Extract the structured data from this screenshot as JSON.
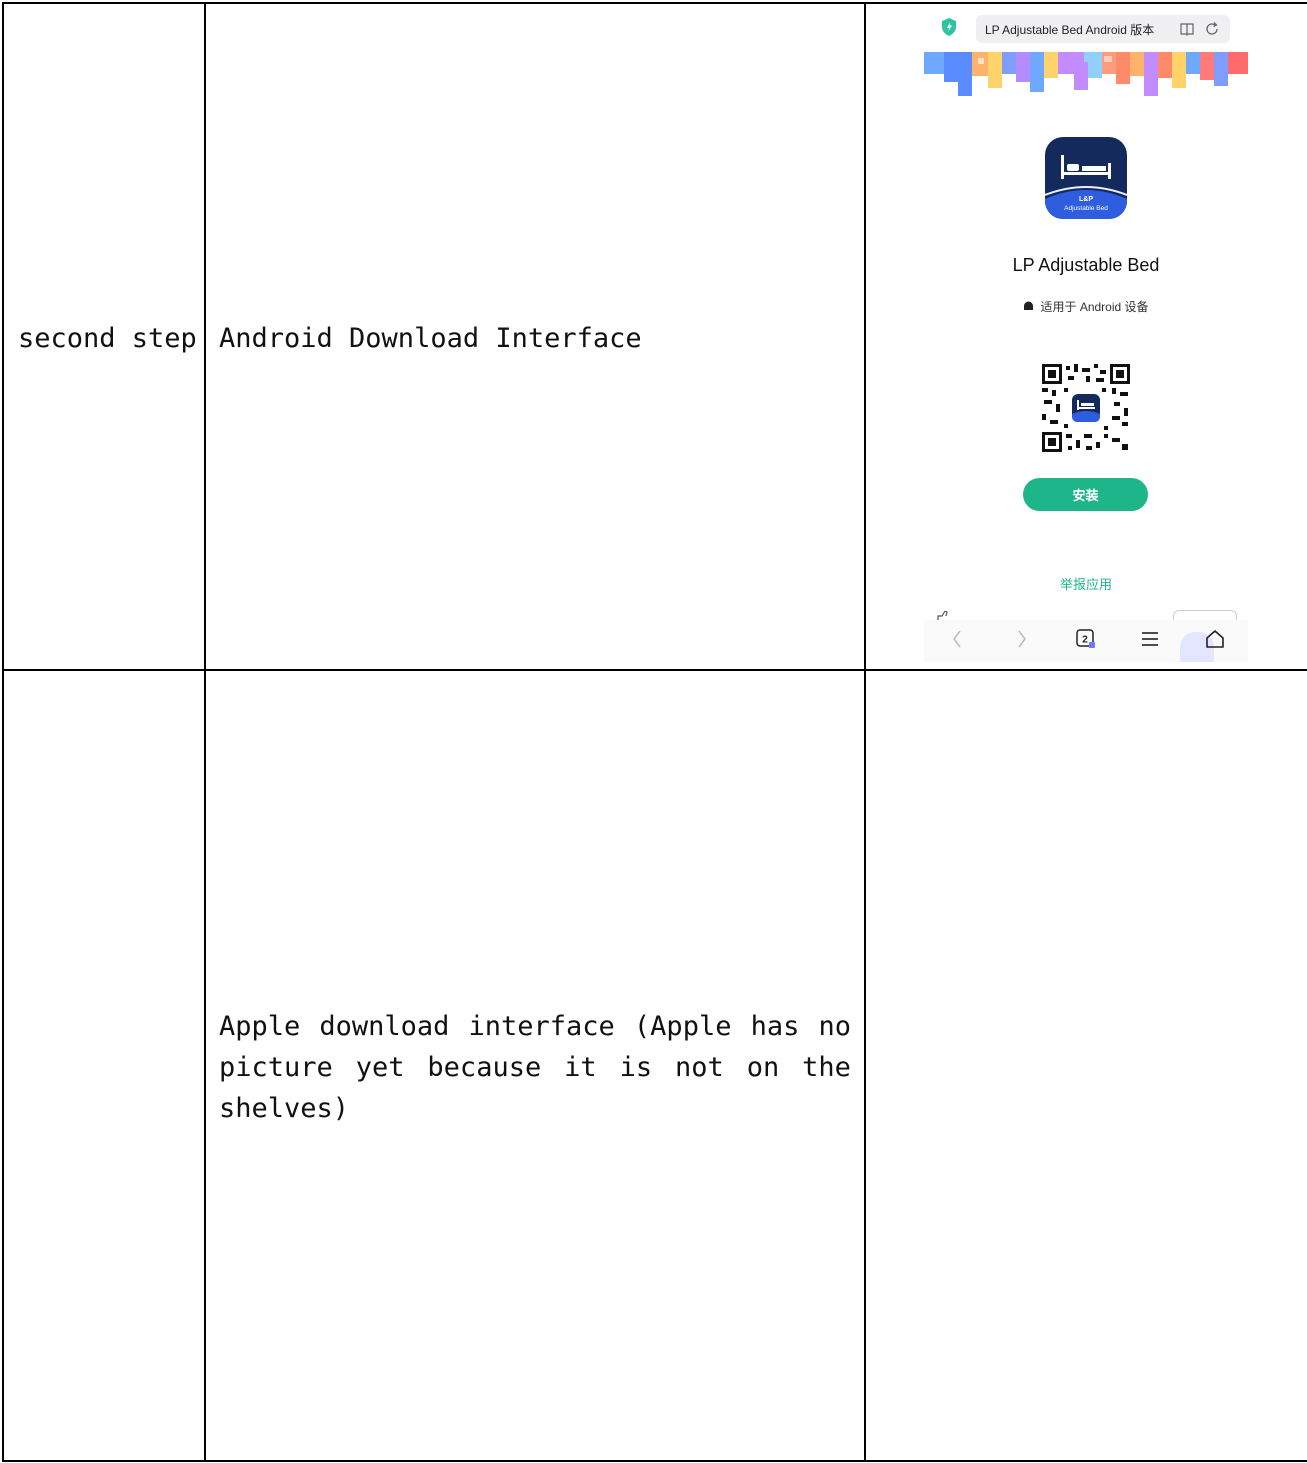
{
  "rows": [
    {
      "step": "second step",
      "description": "Android Download Interface"
    },
    {
      "step": "",
      "description_lines": [
        [
          "Apple",
          "download",
          "interface",
          "(Apple",
          "has",
          "no"
        ],
        [
          "picture",
          "yet",
          "because",
          "it",
          "is",
          "not",
          "on",
          "the"
        ]
      ],
      "description_last_line": "shelves)"
    }
  ],
  "phone": {
    "address_text": "LP Adjustable Bed Android 版本",
    "icons": {
      "shield": "security-shield-icon",
      "reader": "reader-mode-icon",
      "refresh": "refresh-icon"
    },
    "app_icon_label_top": "L&P",
    "app_icon_label_bottom": "Adjustable Bed",
    "app_name": "LP Adjustable Bed",
    "compat_text": "适用于 Android 设备",
    "install_label": "安装",
    "report_label": "举报应用",
    "tab_count": "2",
    "accent_color": "#1fb58a",
    "icon_bg": "#152a5c"
  }
}
